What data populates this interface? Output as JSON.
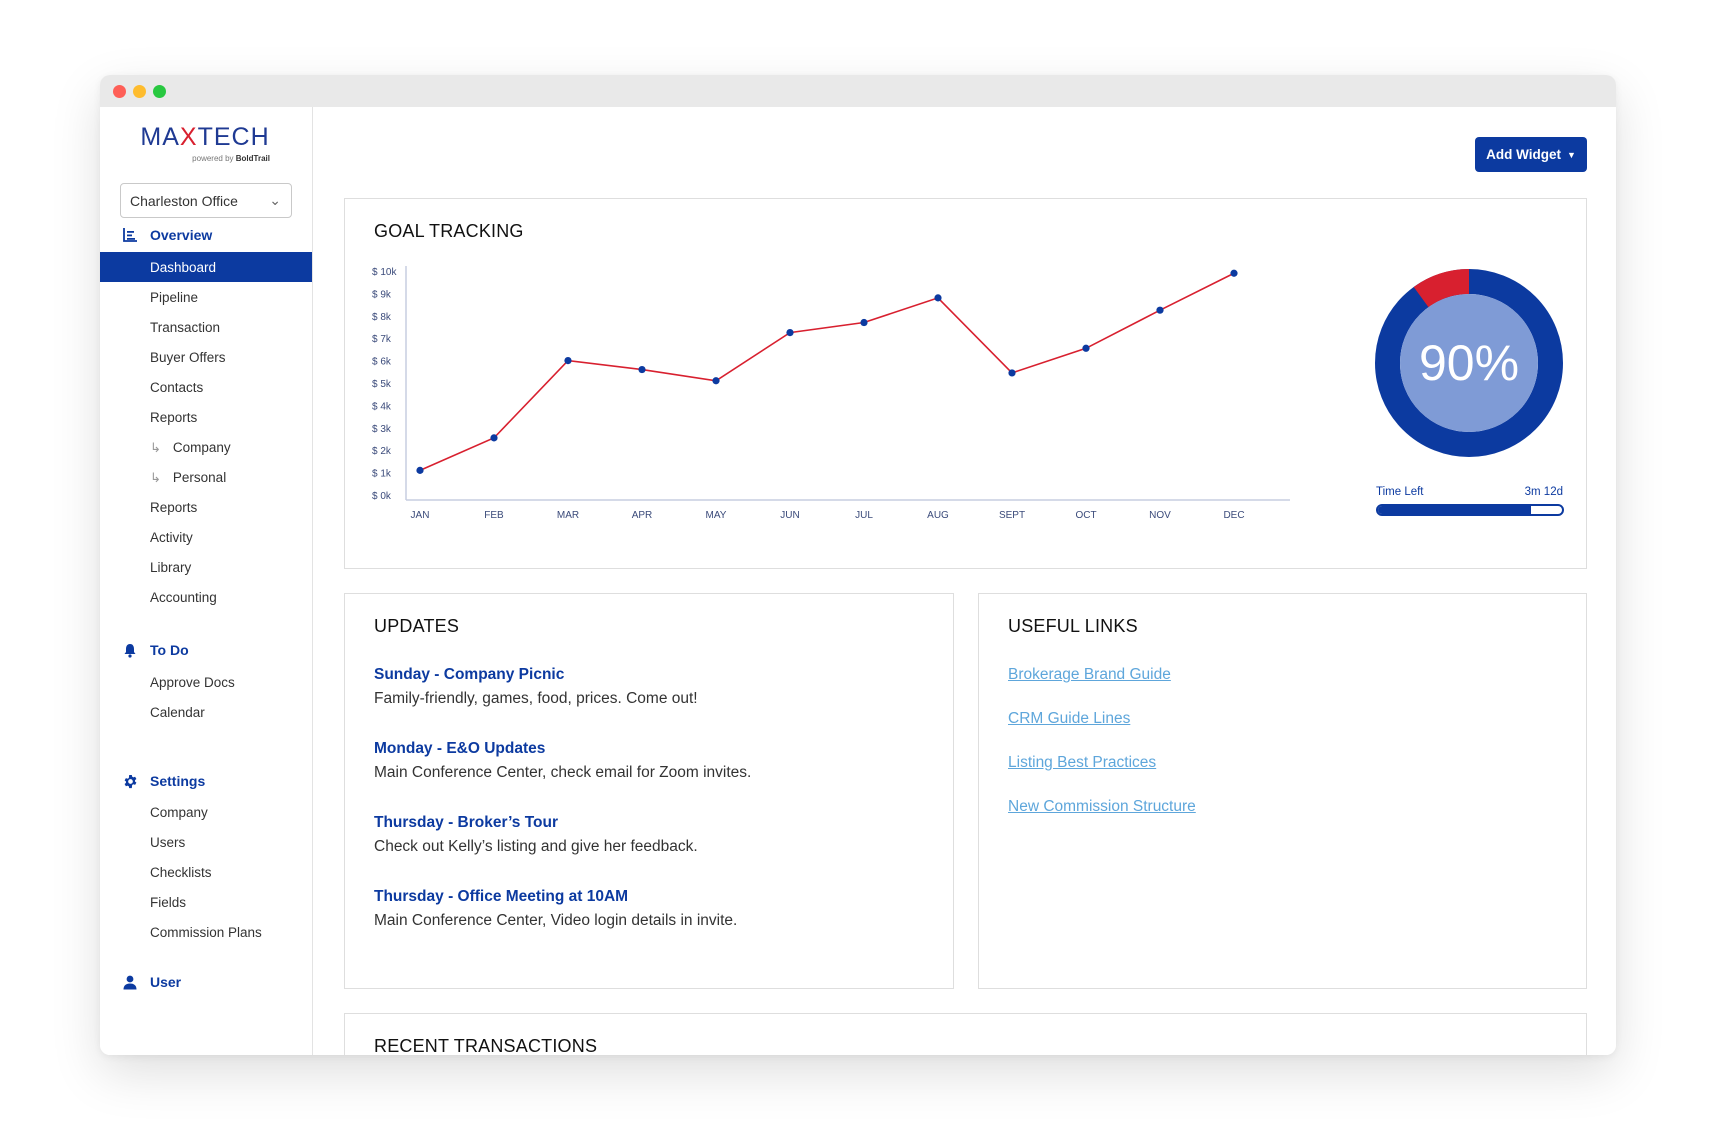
{
  "app": {
    "logo_text_pre": "MA",
    "logo_text_x": "X",
    "logo_text_post": "TECH",
    "logo_powered": "powered by",
    "logo_brand": "BoldTrail"
  },
  "sidebar": {
    "office_select": "Charleston Office",
    "overview": {
      "label": "Overview",
      "icon": "bar-chart-icon",
      "items": [
        {
          "label": "Dashboard"
        },
        {
          "label": "Pipeline"
        },
        {
          "label": "Transaction"
        },
        {
          "label": "Buyer Offers"
        },
        {
          "label": "Contacts"
        },
        {
          "label": "Reports"
        },
        {
          "label": "Company"
        },
        {
          "label": "Personal"
        },
        {
          "label": "Reports"
        },
        {
          "label": "Activity"
        },
        {
          "label": "Library"
        },
        {
          "label": "Accounting"
        }
      ]
    },
    "todo": {
      "label": "To Do",
      "icon": "bell-icon",
      "items": [
        {
          "label": "Approve Docs"
        },
        {
          "label": "Calendar"
        }
      ]
    },
    "settings": {
      "label": "Settings",
      "icon": "gear-icon",
      "items": [
        {
          "label": "Company"
        },
        {
          "label": "Users"
        },
        {
          "label": "Checklists"
        },
        {
          "label": "Fields"
        },
        {
          "label": "Commission Plans"
        }
      ]
    },
    "user": {
      "label": "User",
      "icon": "user-icon"
    }
  },
  "toolbar": {
    "add_widget_label": "Add Widget"
  },
  "goal_tracking": {
    "title": "GOAL TRACKING",
    "percent_label": "90%",
    "percent_value": 90,
    "time_left_label": "Time Left",
    "time_left_value": "3m 12d",
    "time_progress": 0.83
  },
  "chart_data": {
    "type": "line",
    "title": "GOAL TRACKING",
    "categories": [
      "JAN",
      "FEB",
      "MAR",
      "APR",
      "MAY",
      "JUN",
      "JUL",
      "AUG",
      "SEPT",
      "OCT",
      "NOV",
      "DEC"
    ],
    "series": [
      {
        "values": [
          1100,
          2550,
          6000,
          5600,
          5100,
          7250,
          7700,
          8800,
          5450,
          6550,
          8250,
          9900
        ]
      }
    ],
    "ytick_labels": [
      "$ 0k",
      "$ 1k",
      "$ 2k",
      "$ 3k",
      "$ 4k",
      "$ 5k",
      "$ 6k",
      "$ 7k",
      "$ 8k",
      "$ 9k",
      "$ 10k"
    ],
    "ylim": [
      0,
      10000
    ],
    "grid": false,
    "line_color": "#d8202f",
    "marker_color": "#0c3aa0"
  },
  "updates": {
    "title": "UPDATES",
    "items": [
      {
        "title": "Sunday - Company Picnic",
        "body": "Family-friendly, games, food, prices. Come out!"
      },
      {
        "title": "Monday - E&O Updates",
        "body": "Main Conference Center, check email for Zoom invites."
      },
      {
        "title": "Thursday - Broker’s Tour",
        "body": "Check out Kelly’s listing and give her feedback."
      },
      {
        "title": "Thursday - Office Meeting at 10AM",
        "body": "Main Conference Center, Video login details in invite."
      }
    ]
  },
  "useful_links": {
    "title": "USEFUL LINKS",
    "items": [
      {
        "label": "Brokerage Brand Guide"
      },
      {
        "label": "CRM Guide Lines"
      },
      {
        "label": "Listing Best Practices"
      },
      {
        "label": "New Commission Structure"
      }
    ]
  },
  "recent_transactions": {
    "title": "RECENT TRANSACTIONS"
  },
  "colors": {
    "brand_blue": "#0c3aa0",
    "accent_red": "#d8202f",
    "link_blue": "#5ea6db",
    "donut_inner": "#7f9bd6"
  }
}
